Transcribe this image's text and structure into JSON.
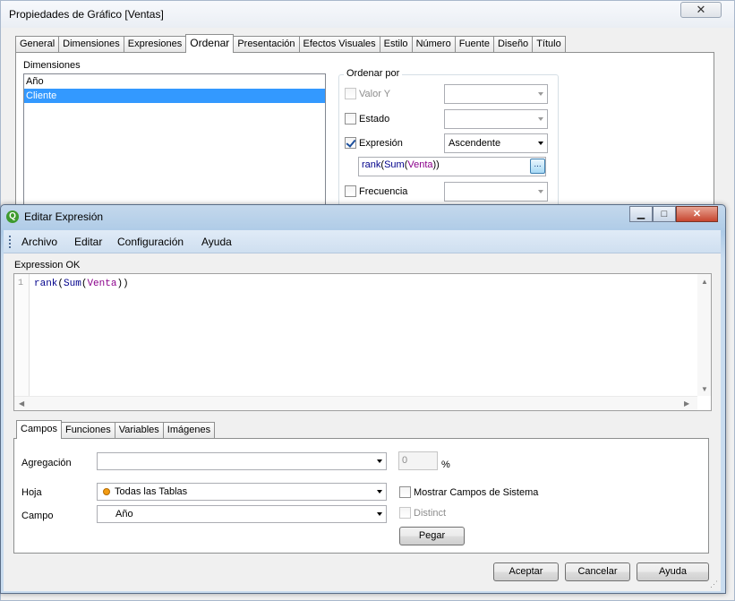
{
  "bg": {
    "title": "Propiedades de Gráfico [Ventas]",
    "close": "✕",
    "tabs": [
      "General",
      "Dimensiones",
      "Expresiones",
      "Ordenar",
      "Presentación",
      "Efectos Visuales",
      "Estilo",
      "Número",
      "Fuente",
      "Diseño",
      "Título"
    ],
    "active_tab": "Ordenar",
    "dimensions_label": "Dimensiones",
    "dimensions": [
      "Año",
      "Cliente"
    ],
    "selected_dimension": "Cliente",
    "sort_by_label": "Ordenar por",
    "sort_options": {
      "valor_y": "Valor Y",
      "estado": "Estado",
      "expresion": "Expresión",
      "expresion_order": "Ascendente",
      "frecuencia": "Frecuencia"
    },
    "expr_text": [
      "rank",
      "(",
      "Sum",
      "(",
      "Venta",
      "))"
    ],
    "ellipsis": "..."
  },
  "editor": {
    "logo": "Q",
    "title": "Editar Expresión",
    "menu": [
      "Archivo",
      "Editar",
      "Configuración",
      "Ayuda"
    ],
    "status": "Expression OK",
    "line_number": "1",
    "code": [
      "rank",
      "(",
      "Sum",
      "(",
      "Venta",
      "))"
    ],
    "tabs": [
      "Campos",
      "Funciones",
      "Variables",
      "Imágenes"
    ],
    "active_tab": "Campos",
    "fields": {
      "agregacion_label": "Agregación",
      "agregacion_value": "",
      "percent_value": "0",
      "percent_sign": "%",
      "hoja_label": "Hoja",
      "hoja_value": "Todas las Tablas",
      "campo_label": "Campo",
      "campo_value": "Año",
      "mostrar_sistema": "Mostrar Campos de Sistema",
      "distinct": "Distinct",
      "pegar": "Pegar"
    },
    "buttons": {
      "aceptar": "Aceptar",
      "cancelar": "Cancelar",
      "ayuda": "Ayuda"
    }
  }
}
